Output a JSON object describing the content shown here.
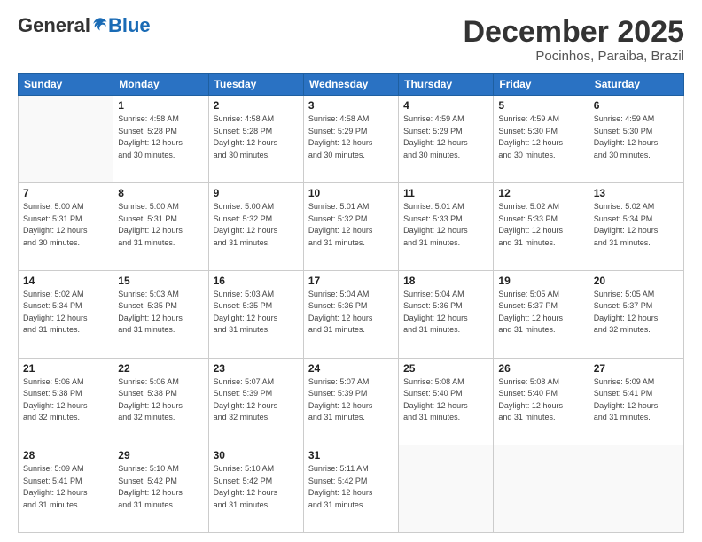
{
  "header": {
    "logo_general": "General",
    "logo_blue": "Blue",
    "month": "December 2025",
    "location": "Pocinhos, Paraiba, Brazil"
  },
  "days_of_week": [
    "Sunday",
    "Monday",
    "Tuesday",
    "Wednesday",
    "Thursday",
    "Friday",
    "Saturday"
  ],
  "weeks": [
    [
      {
        "day": "",
        "info": ""
      },
      {
        "day": "1",
        "info": "Sunrise: 4:58 AM\nSunset: 5:28 PM\nDaylight: 12 hours\nand 30 minutes."
      },
      {
        "day": "2",
        "info": "Sunrise: 4:58 AM\nSunset: 5:28 PM\nDaylight: 12 hours\nand 30 minutes."
      },
      {
        "day": "3",
        "info": "Sunrise: 4:58 AM\nSunset: 5:29 PM\nDaylight: 12 hours\nand 30 minutes."
      },
      {
        "day": "4",
        "info": "Sunrise: 4:59 AM\nSunset: 5:29 PM\nDaylight: 12 hours\nand 30 minutes."
      },
      {
        "day": "5",
        "info": "Sunrise: 4:59 AM\nSunset: 5:30 PM\nDaylight: 12 hours\nand 30 minutes."
      },
      {
        "day": "6",
        "info": "Sunrise: 4:59 AM\nSunset: 5:30 PM\nDaylight: 12 hours\nand 30 minutes."
      }
    ],
    [
      {
        "day": "7",
        "info": "Sunrise: 5:00 AM\nSunset: 5:31 PM\nDaylight: 12 hours\nand 30 minutes."
      },
      {
        "day": "8",
        "info": "Sunrise: 5:00 AM\nSunset: 5:31 PM\nDaylight: 12 hours\nand 31 minutes."
      },
      {
        "day": "9",
        "info": "Sunrise: 5:00 AM\nSunset: 5:32 PM\nDaylight: 12 hours\nand 31 minutes."
      },
      {
        "day": "10",
        "info": "Sunrise: 5:01 AM\nSunset: 5:32 PM\nDaylight: 12 hours\nand 31 minutes."
      },
      {
        "day": "11",
        "info": "Sunrise: 5:01 AM\nSunset: 5:33 PM\nDaylight: 12 hours\nand 31 minutes."
      },
      {
        "day": "12",
        "info": "Sunrise: 5:02 AM\nSunset: 5:33 PM\nDaylight: 12 hours\nand 31 minutes."
      },
      {
        "day": "13",
        "info": "Sunrise: 5:02 AM\nSunset: 5:34 PM\nDaylight: 12 hours\nand 31 minutes."
      }
    ],
    [
      {
        "day": "14",
        "info": "Sunrise: 5:02 AM\nSunset: 5:34 PM\nDaylight: 12 hours\nand 31 minutes."
      },
      {
        "day": "15",
        "info": "Sunrise: 5:03 AM\nSunset: 5:35 PM\nDaylight: 12 hours\nand 31 minutes."
      },
      {
        "day": "16",
        "info": "Sunrise: 5:03 AM\nSunset: 5:35 PM\nDaylight: 12 hours\nand 31 minutes."
      },
      {
        "day": "17",
        "info": "Sunrise: 5:04 AM\nSunset: 5:36 PM\nDaylight: 12 hours\nand 31 minutes."
      },
      {
        "day": "18",
        "info": "Sunrise: 5:04 AM\nSunset: 5:36 PM\nDaylight: 12 hours\nand 31 minutes."
      },
      {
        "day": "19",
        "info": "Sunrise: 5:05 AM\nSunset: 5:37 PM\nDaylight: 12 hours\nand 31 minutes."
      },
      {
        "day": "20",
        "info": "Sunrise: 5:05 AM\nSunset: 5:37 PM\nDaylight: 12 hours\nand 32 minutes."
      }
    ],
    [
      {
        "day": "21",
        "info": "Sunrise: 5:06 AM\nSunset: 5:38 PM\nDaylight: 12 hours\nand 32 minutes."
      },
      {
        "day": "22",
        "info": "Sunrise: 5:06 AM\nSunset: 5:38 PM\nDaylight: 12 hours\nand 32 minutes."
      },
      {
        "day": "23",
        "info": "Sunrise: 5:07 AM\nSunset: 5:39 PM\nDaylight: 12 hours\nand 32 minutes."
      },
      {
        "day": "24",
        "info": "Sunrise: 5:07 AM\nSunset: 5:39 PM\nDaylight: 12 hours\nand 31 minutes."
      },
      {
        "day": "25",
        "info": "Sunrise: 5:08 AM\nSunset: 5:40 PM\nDaylight: 12 hours\nand 31 minutes."
      },
      {
        "day": "26",
        "info": "Sunrise: 5:08 AM\nSunset: 5:40 PM\nDaylight: 12 hours\nand 31 minutes."
      },
      {
        "day": "27",
        "info": "Sunrise: 5:09 AM\nSunset: 5:41 PM\nDaylight: 12 hours\nand 31 minutes."
      }
    ],
    [
      {
        "day": "28",
        "info": "Sunrise: 5:09 AM\nSunset: 5:41 PM\nDaylight: 12 hours\nand 31 minutes."
      },
      {
        "day": "29",
        "info": "Sunrise: 5:10 AM\nSunset: 5:42 PM\nDaylight: 12 hours\nand 31 minutes."
      },
      {
        "day": "30",
        "info": "Sunrise: 5:10 AM\nSunset: 5:42 PM\nDaylight: 12 hours\nand 31 minutes."
      },
      {
        "day": "31",
        "info": "Sunrise: 5:11 AM\nSunset: 5:42 PM\nDaylight: 12 hours\nand 31 minutes."
      },
      {
        "day": "",
        "info": ""
      },
      {
        "day": "",
        "info": ""
      },
      {
        "day": "",
        "info": ""
      }
    ]
  ]
}
